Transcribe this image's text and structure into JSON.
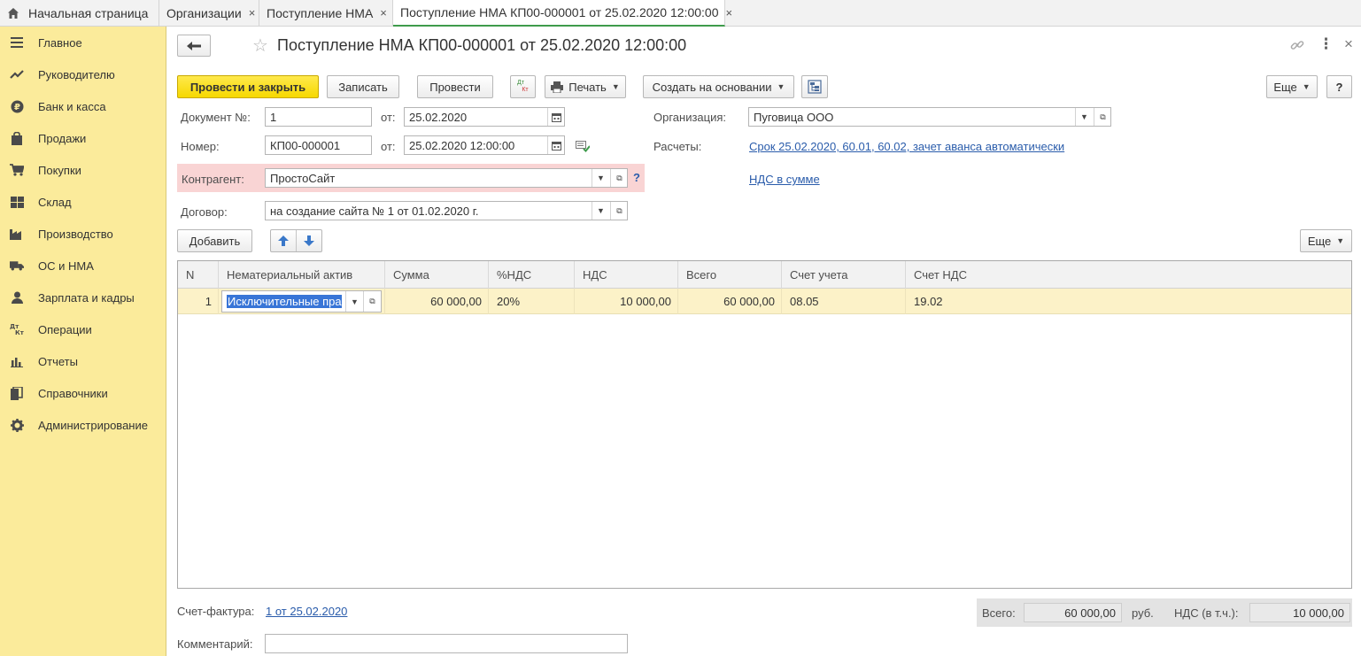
{
  "tabs": {
    "home": "Начальная страница",
    "orgs": "Организации",
    "nma": "Поступление НМА",
    "doc": "Поступление НМА КП00-000001 от 25.02.2020 12:00:00",
    "close": "×"
  },
  "sidebar": {
    "items": [
      {
        "label": "Главное",
        "icon": "menu-icon"
      },
      {
        "label": "Руководителю",
        "icon": "trend-icon"
      },
      {
        "label": "Банк и касса",
        "icon": "ruble-icon"
      },
      {
        "label": "Продажи",
        "icon": "bag-icon"
      },
      {
        "label": "Покупки",
        "icon": "cart-icon"
      },
      {
        "label": "Склад",
        "icon": "grid-icon"
      },
      {
        "label": "Производство",
        "icon": "factory-icon"
      },
      {
        "label": "ОС и НМА",
        "icon": "truck-icon"
      },
      {
        "label": "Зарплата и кадры",
        "icon": "person-icon"
      },
      {
        "label": "Операции",
        "icon": "dt-kt-icon"
      },
      {
        "label": "Отчеты",
        "icon": "bar-chart-icon"
      },
      {
        "label": "Справочники",
        "icon": "books-icon"
      },
      {
        "label": "Администрирование",
        "icon": "gear-icon"
      }
    ]
  },
  "header": {
    "title": "Поступление НМА КП00-000001 от 25.02.2020 12:00:00",
    "back": "🡐",
    "star": "☆",
    "more": "⋮"
  },
  "toolbar": {
    "post_close": "Провести и закрыть",
    "save": "Записать",
    "post": "Провести",
    "dtkt_top": "Дт",
    "dtkt_bottom": "Кт",
    "print": "Печать",
    "create_based": "Создать на основании",
    "more": "Еще",
    "help": "?"
  },
  "form": {
    "doc_no_label": "Документ №:",
    "doc_no": "1",
    "from_label": "от:",
    "doc_date": "25.02.2020",
    "number_label": "Номер:",
    "number": "КП00-000001",
    "number_date": "25.02.2020 12:00:00",
    "org_label": "Организация:",
    "org": "Пуговица ООО",
    "settlements_label": "Расчеты:",
    "settlements": "Срок 25.02.2020, 60.01, 60.02, зачет аванса автоматически",
    "counterparty_label": "Контрагент:",
    "counterparty": "ПростоСайт",
    "contract_label": "Договор:",
    "contract": "на создание сайта № 1 от 01.02.2020 г.",
    "vat_link": "НДС в сумме",
    "question": "?"
  },
  "table_toolbar": {
    "add": "Добавить",
    "more": "Еще"
  },
  "table": {
    "columns": [
      "N",
      "Нематериальный актив",
      "Сумма",
      "%НДС",
      "НДС",
      "Всего",
      "Счет учета",
      "Счет НДС"
    ],
    "rows": [
      {
        "n": "1",
        "asset": "Исключительные пра",
        "sum": "60 000,00",
        "vat_rate": "20%",
        "vat": "10 000,00",
        "total": "60 000,00",
        "account": "08.05",
        "vat_account": "19.02"
      }
    ]
  },
  "footer": {
    "invoice_label": "Счет-фактура:",
    "invoice": "1 от 25.02.2020",
    "comment_label": "Комментарий:",
    "comment": "",
    "total_label": "Всего:",
    "total": "60 000,00",
    "currency": "руб.",
    "vat_label": "НДС (в т.ч.):",
    "vat": "10 000,00"
  },
  "colors": {
    "sidebar_bg": "#fbeb9b",
    "primary_button": "#f6d800",
    "active_tab_underline": "#3f9b4c",
    "link": "#2a5cab",
    "counterparty_highlight": "#f9d4d4",
    "selected_row": "#fcf2c8"
  }
}
